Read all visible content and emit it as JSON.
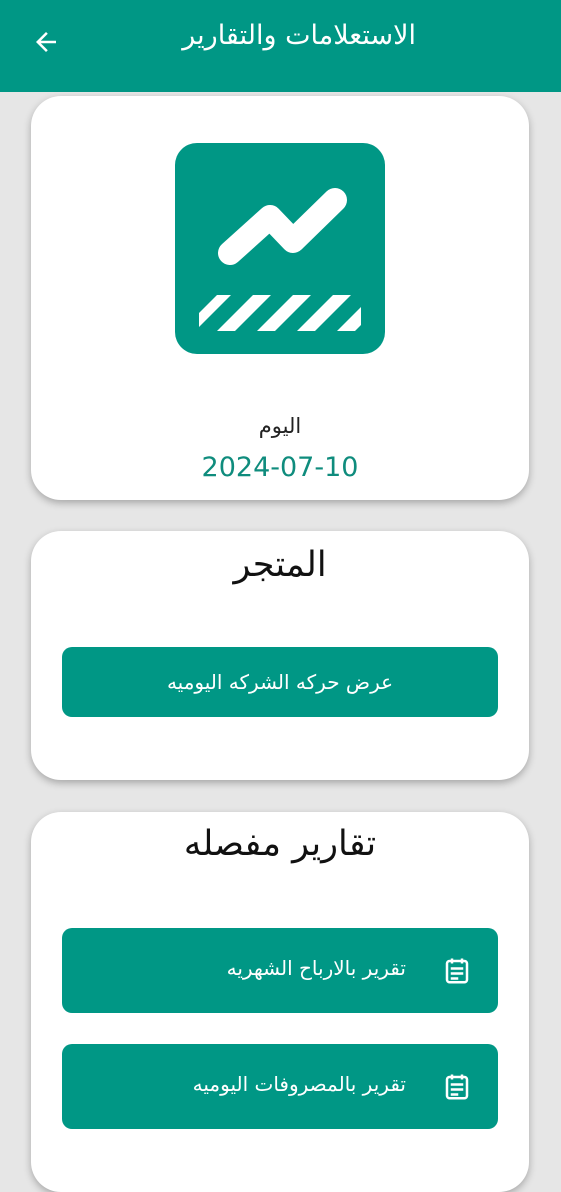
{
  "app_bar": {
    "title": "الاستعلامات والتقارير",
    "back_icon": "arrow-back-icon",
    "color": "#009785"
  },
  "today_card": {
    "logo_icon": "chart-trend-logo-icon",
    "label": "اليوم",
    "date": "2024-07-10"
  },
  "store_card": {
    "title": "المتجر",
    "button_label": "عرض حركه الشركه اليوميه"
  },
  "reports_card": {
    "title": "تقارير مفصله",
    "items": [
      {
        "label": "تقرير بالارباح الشهريه",
        "icon": "report-document-icon"
      },
      {
        "label": "تقرير بالمصروفات اليوميه",
        "icon": "report-document-icon"
      }
    ]
  }
}
